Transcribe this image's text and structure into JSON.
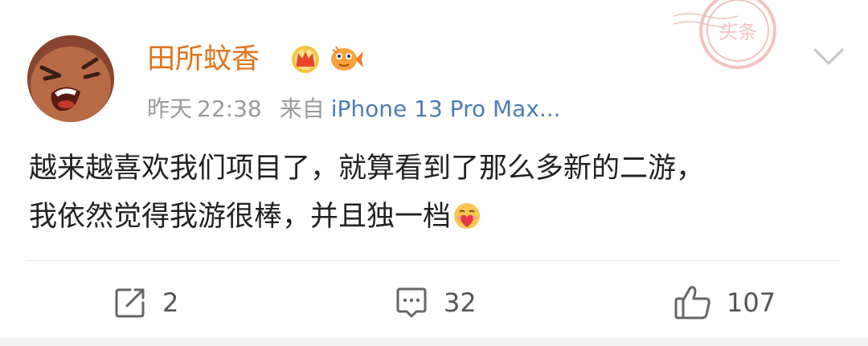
{
  "post": {
    "username": "田所蚊香",
    "badges": [
      "crown-badge",
      "fish-badge"
    ],
    "meta": {
      "date": "昨天",
      "time": "22:38",
      "from_label": "来自",
      "device": "iPhone 13 Pro Max..."
    },
    "content_line1": "越来越喜欢我们项目了，就算看到了那么多新的二游，",
    "content_line2": "我依然觉得我游很棒，并且独一档",
    "content_emoji": "heart-hug-emoji",
    "stamp_text": "头条"
  },
  "actions": {
    "repost_count": "2",
    "comment_count": "32",
    "like_count": "107",
    "repost_icon": "share-icon",
    "comment_icon": "comment-icon",
    "like_icon": "thumbs-up-icon"
  },
  "colors": {
    "username": "#e2731a",
    "device_link": "#4d7db5",
    "meta": "#9a9a9a",
    "text": "#222222"
  }
}
